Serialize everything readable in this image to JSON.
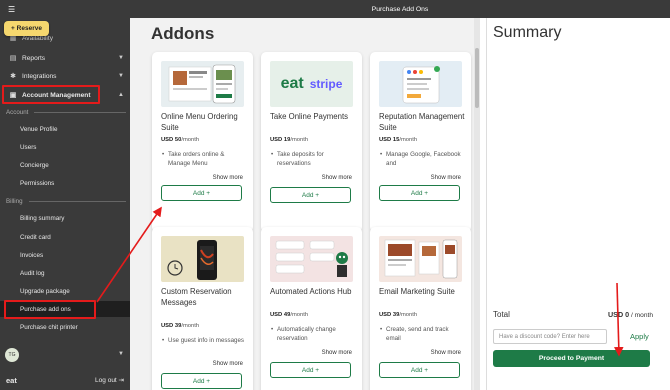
{
  "topbar": {
    "title": "Purchase Add Ons"
  },
  "sidebar": {
    "collapse_glyph": "☰",
    "reserve_label": "+ Reserve",
    "partial_item": "Availability",
    "items": [
      {
        "label": "Reports",
        "icon": "bar-chart-icon"
      },
      {
        "label": "Integrations",
        "icon": "gear-icon"
      },
      {
        "label": "Account Management",
        "icon": "lock-icon"
      }
    ],
    "section_account": "Account",
    "account_items": [
      "Venue Profile",
      "Users",
      "Concierge",
      "Permissions"
    ],
    "section_billing": "Billing",
    "billing_items": [
      "Billing summary",
      "Credit card",
      "Invoices",
      "Audit log",
      "Upgrade package",
      "Purchase add ons",
      "Purchase chit printer"
    ],
    "avatar": "TG",
    "logo": "eat",
    "logout": "Log out"
  },
  "main": {
    "title": "Addons",
    "cards": [
      {
        "name": "Online Menu Ordering Suite",
        "price_currency": "USD",
        "price_amount": "50",
        "price_period": "/month",
        "desc": "Take orders online & Manage Menu",
        "show_more": "Show more",
        "add": "Add +"
      },
      {
        "name": "Take Online Payments",
        "price_currency": "USD",
        "price_amount": "19",
        "price_period": "/month",
        "desc": "Take deposits for reservations",
        "show_more": "Show more",
        "add": "Add +",
        "logo_left": "eat",
        "logo_right": "stripe"
      },
      {
        "name": "Reputation Management Suite",
        "price_currency": "USD",
        "price_amount": "15",
        "price_period": "/month",
        "desc": "Manage Google, Facebook and",
        "show_more": "Show more",
        "add": "Add +"
      },
      {
        "name": "Custom Reservation Messages",
        "price_currency": "USD",
        "price_amount": "39",
        "price_period": "/month",
        "desc": "Use guest info in messages",
        "show_more": "Show more",
        "add": "Add +"
      },
      {
        "name": "Automated Actions Hub",
        "price_currency": "USD",
        "price_amount": "49",
        "price_period": "/month",
        "desc": "Automatically change reservation",
        "show_more": "Show more",
        "add": "Add +"
      },
      {
        "name": "Email Marketing Suite",
        "price_currency": "USD",
        "price_amount": "39",
        "price_period": "/month",
        "desc": "Create, send and track email",
        "show_more": "Show more",
        "add": "Add +"
      }
    ]
  },
  "summary": {
    "title": "Summary",
    "total_label": "Total",
    "total_currency": "USD",
    "total_amount": "0",
    "total_period": "/ month",
    "discount_placeholder": "Have a discount code? Enter here",
    "apply": "Apply",
    "proceed": "Proceed to Payment"
  },
  "colors": {
    "accent": "#1e7b47",
    "sidebar": "#3a3a3a",
    "reserve": "#f5d76e",
    "highlight": "#e41b1b"
  }
}
